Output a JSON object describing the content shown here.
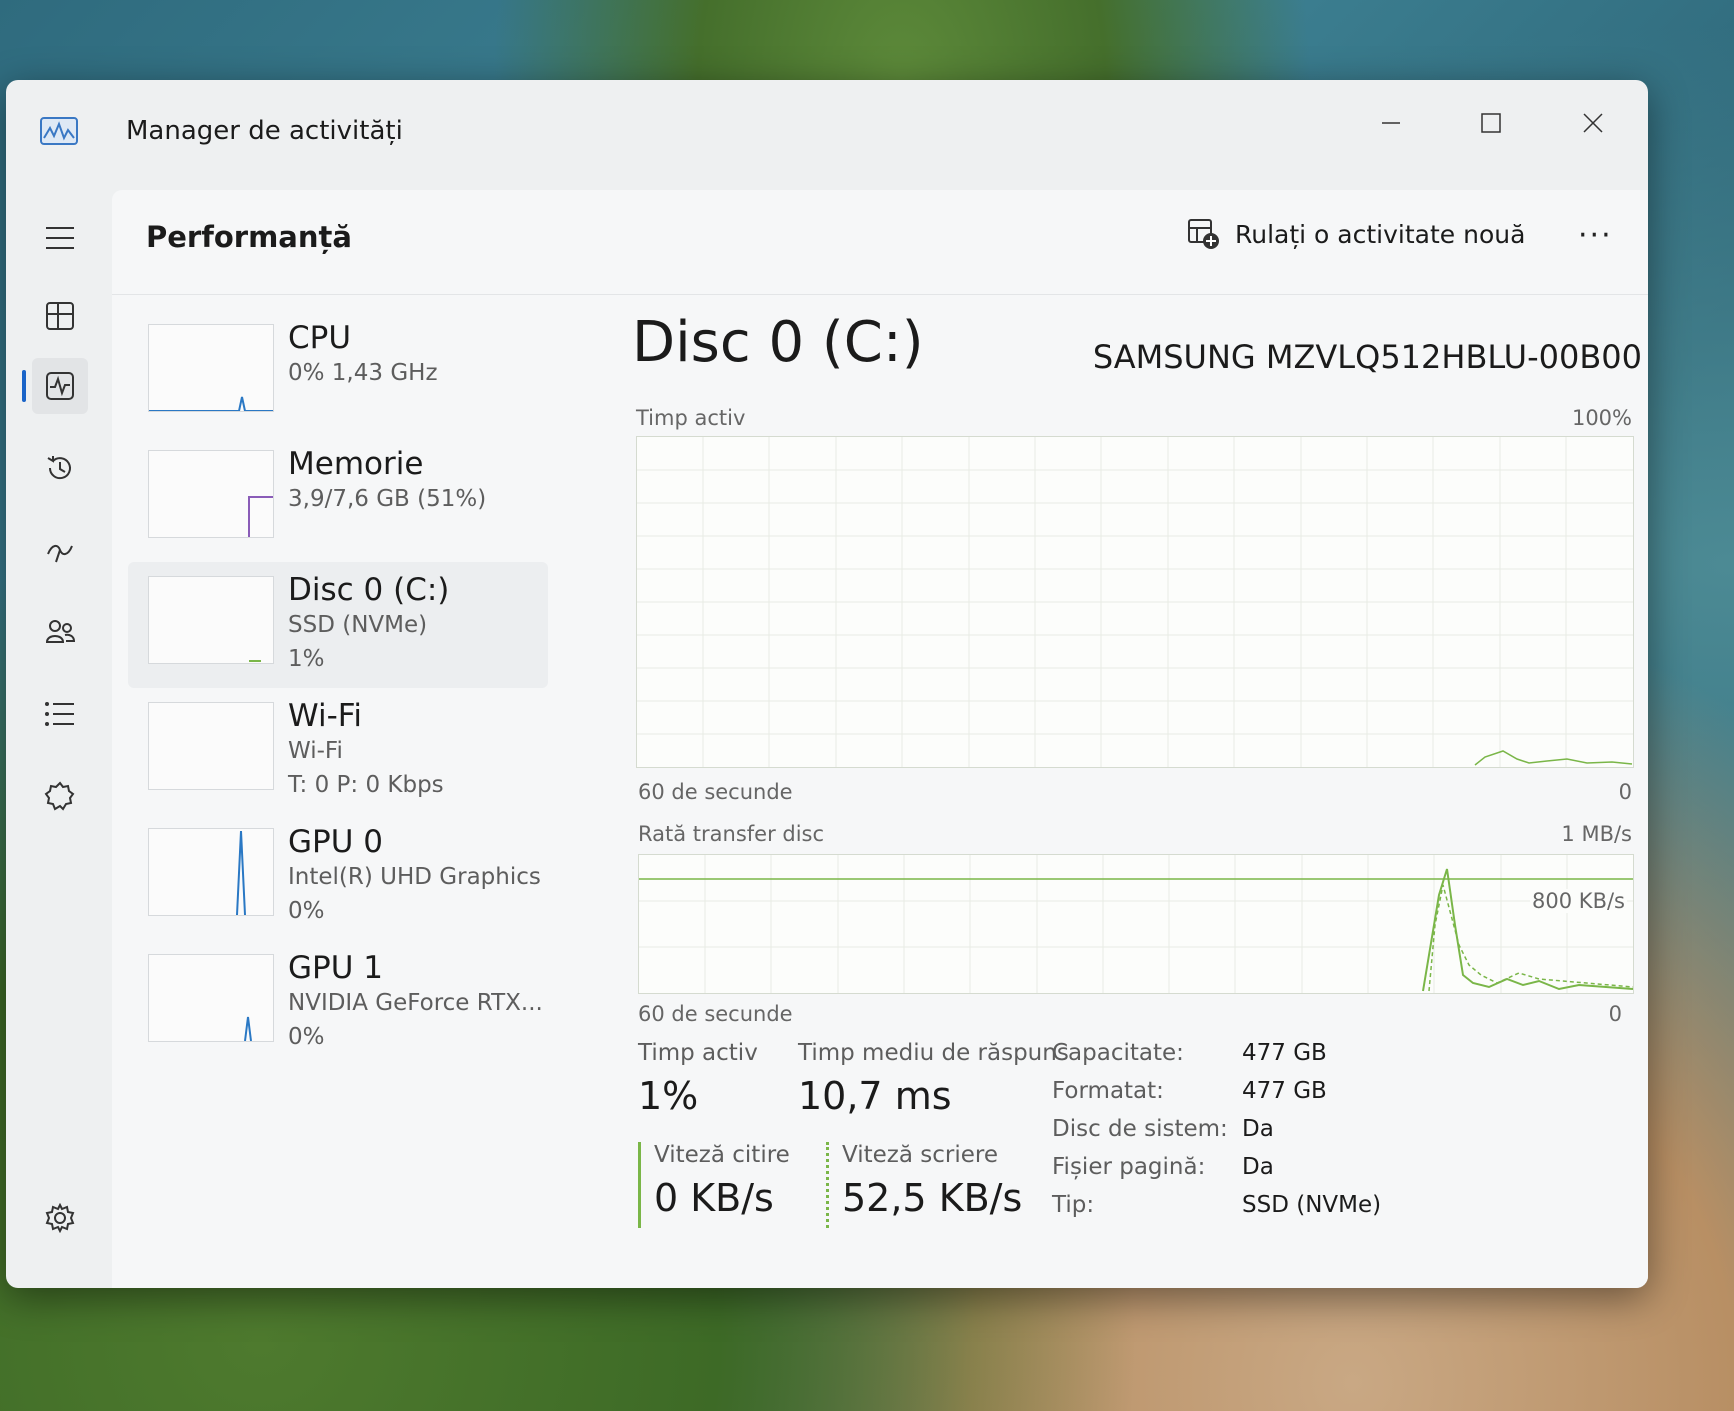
{
  "window": {
    "title": "Manager de activități"
  },
  "header": {
    "title": "Performanță",
    "run_task_label": "Rulați o activitate nouă",
    "more_label": "···"
  },
  "sidebar": {
    "items": [
      {
        "name": "menu",
        "icon": "hamburger-menu-icon"
      },
      {
        "name": "processes",
        "icon": "processes-icon"
      },
      {
        "name": "performance",
        "icon": "performance-icon",
        "active": true
      },
      {
        "name": "app-history",
        "icon": "history-icon"
      },
      {
        "name": "startup",
        "icon": "startup-apps-icon"
      },
      {
        "name": "users",
        "icon": "users-icon"
      },
      {
        "name": "details",
        "icon": "details-list-icon"
      },
      {
        "name": "services",
        "icon": "services-icon"
      },
      {
        "name": "settings",
        "icon": "gear-icon"
      }
    ]
  },
  "devices": [
    {
      "name": "CPU",
      "sub": "0%  1,43 GHz",
      "sub2": "",
      "selected": false
    },
    {
      "name": "Memorie",
      "sub": "3,9/7,6 GB (51%)",
      "sub2": "",
      "selected": false
    },
    {
      "name": "Disc 0 (C:)",
      "sub": "SSD (NVMe)",
      "sub2": "1%",
      "selected": true
    },
    {
      "name": "Wi-Fi",
      "sub": "Wi-Fi",
      "sub2": "T: 0  P: 0 Kbps",
      "selected": false
    },
    {
      "name": "GPU 0",
      "sub": "Intel(R) UHD Graphics",
      "sub2": "0%",
      "selected": false
    },
    {
      "name": "GPU 1",
      "sub": "NVIDIA GeForce RTX...",
      "sub2": "0%",
      "selected": false
    }
  ],
  "detail": {
    "title": "Disc 0 (C:)",
    "model": "SAMSUNG MZVLQ512HBLU-00B00",
    "graph1": {
      "label": "Timp activ",
      "max": "100%",
      "time": "60 de secunde",
      "min": "0"
    },
    "graph2": {
      "label": "Rată transfer disc",
      "max": "1 MB/s",
      "mid": "800 KB/s",
      "time": "60 de secunde",
      "min": "0"
    }
  },
  "stats": {
    "active_time_label": "Timp activ",
    "active_time_value": "1%",
    "response_label": "Timp mediu de răspuns",
    "response_value": "10,7 ms",
    "read_label": "Viteză citire",
    "read_value": "0 KB/s",
    "write_label": "Viteză scriere",
    "write_value": "52,5 KB/s"
  },
  "properties": [
    {
      "label": "Capacitate:",
      "value": "477 GB"
    },
    {
      "label": "Formatat:",
      "value": "477 GB"
    },
    {
      "label": "Disc de sistem:",
      "value": "Da"
    },
    {
      "label": "Fișier pagină:",
      "value": "Da"
    },
    {
      "label": "Tip:",
      "value": "SSD (NVMe)"
    }
  ],
  "colors": {
    "disk_green": "#7ab648",
    "accent": "#1a64c8"
  }
}
